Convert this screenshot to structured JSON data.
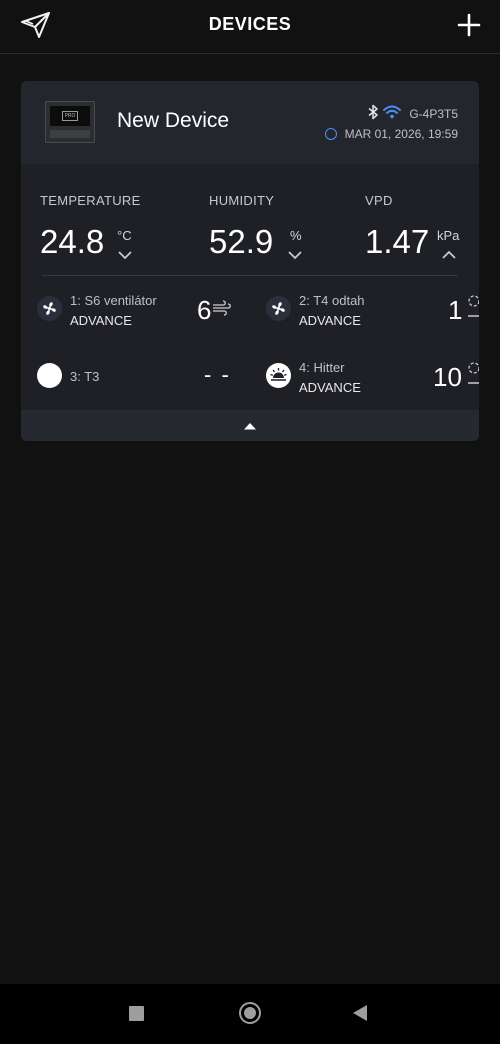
{
  "header": {
    "title": "DEVICES",
    "logo_icon": "paper-plane-logo-icon",
    "add_icon": "plus-icon"
  },
  "device": {
    "name": "New Device",
    "id": "G-4P3T5",
    "timestamp": "MAR 01, 2026, 19:59",
    "connections": [
      "bluetooth-icon",
      "wifi-icon"
    ],
    "accent": "#4d8ff3"
  },
  "readings": {
    "temperature": {
      "label": "TEMPERATURE",
      "value": "24.8",
      "unit": "°C",
      "trend": "down"
    },
    "humidity": {
      "label": "HUMIDITY",
      "value": "52.9",
      "unit": "%",
      "trend": "down"
    },
    "vpd": {
      "label": "VPD",
      "value": "1.47",
      "unit": "kPa",
      "trend": "up"
    }
  },
  "ports": [
    {
      "name": "1: S6 ventilátor",
      "mode": "ADVANCE",
      "level": "6",
      "icon": "fan-icon",
      "level_icon": "wind-icon"
    },
    {
      "name": "2: T4 odtah",
      "mode": "ADVANCE",
      "level": "1",
      "icon": "fan-icon",
      "level_icon": "level-gauge-icon"
    },
    {
      "name": "3: T3",
      "mode": "",
      "level": "- -",
      "icon": "empty-port-icon",
      "level_icon": ""
    },
    {
      "name": "4: Hitter",
      "mode": "ADVANCE",
      "level": "10",
      "icon": "heater-icon",
      "level_icon": "level-gauge-icon"
    }
  ],
  "nav": {
    "recent_icon": "recent-apps-icon",
    "home_icon": "home-icon",
    "back_icon": "back-icon"
  }
}
